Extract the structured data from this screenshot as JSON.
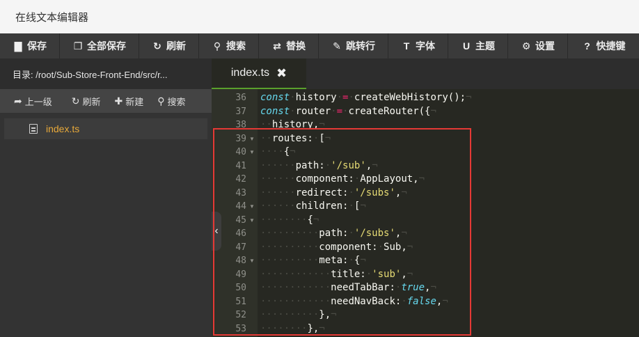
{
  "app": {
    "title": "在线文本编辑器"
  },
  "toolbar": {
    "buttons": [
      {
        "label": "保存",
        "icon": "save-icon",
        "glyph": "▇"
      },
      {
        "label": "全部保存",
        "icon": "save-all-icon",
        "glyph": "❐"
      },
      {
        "label": "刷新",
        "icon": "refresh-icon",
        "glyph": "↻"
      },
      {
        "label": "搜索",
        "icon": "search-icon",
        "glyph": "⚲"
      },
      {
        "label": "替换",
        "icon": "replace-icon",
        "glyph": "⇄"
      },
      {
        "label": "跳转行",
        "icon": "pin-icon",
        "glyph": "✎"
      },
      {
        "label": "字体",
        "icon": "font-icon",
        "glyph": "T"
      },
      {
        "label": "主题",
        "icon": "theme-icon",
        "glyph": "U"
      },
      {
        "label": "设置",
        "icon": "gear-icon",
        "glyph": "⚙"
      },
      {
        "label": "快捷键",
        "icon": "help-icon",
        "glyph": "?"
      }
    ]
  },
  "sidebar": {
    "directory": "目录: /root/Sub-Store-Front-End/src/r...",
    "actions": [
      {
        "label": "上一级",
        "icon": "arrow-up-icon",
        "glyph": "➦"
      },
      {
        "label": "刷新",
        "icon": "refresh-icon",
        "glyph": "↻"
      },
      {
        "label": "新建",
        "icon": "plus-icon",
        "glyph": "✚"
      },
      {
        "label": "搜索",
        "icon": "search-icon",
        "glyph": "⚲"
      }
    ],
    "files": [
      {
        "name": "index.ts",
        "icon": "file-icon"
      }
    ]
  },
  "tab": {
    "label": "index.ts",
    "close": "✖"
  },
  "editor": {
    "line_numbers": [
      "36",
      "37",
      "38",
      "39",
      "40",
      "41",
      "42",
      "43",
      "44",
      "45",
      "46",
      "47",
      "48",
      "49",
      "50",
      "51",
      "52",
      "53"
    ],
    "fold_markers": [
      39,
      40,
      44,
      45,
      48
    ],
    "lines": [
      "const history = createWebHistory();",
      "const router = createRouter({",
      "  history,",
      "  routes: [",
      "    {",
      "      path: '/sub',",
      "      component: AppLayout,",
      "      redirect: '/subs',",
      "      children: [",
      "        {",
      "          path: '/subs',",
      "          component: Sub,",
      "          meta: {",
      "            title: 'sub',",
      "            needTabBar: true,",
      "            needNavBack: false,",
      "          },",
      "        },"
    ]
  },
  "colors": {
    "accent_tab": "#5aa02c",
    "highlight_box": "#e53935",
    "file_active": "#e8a93a"
  }
}
